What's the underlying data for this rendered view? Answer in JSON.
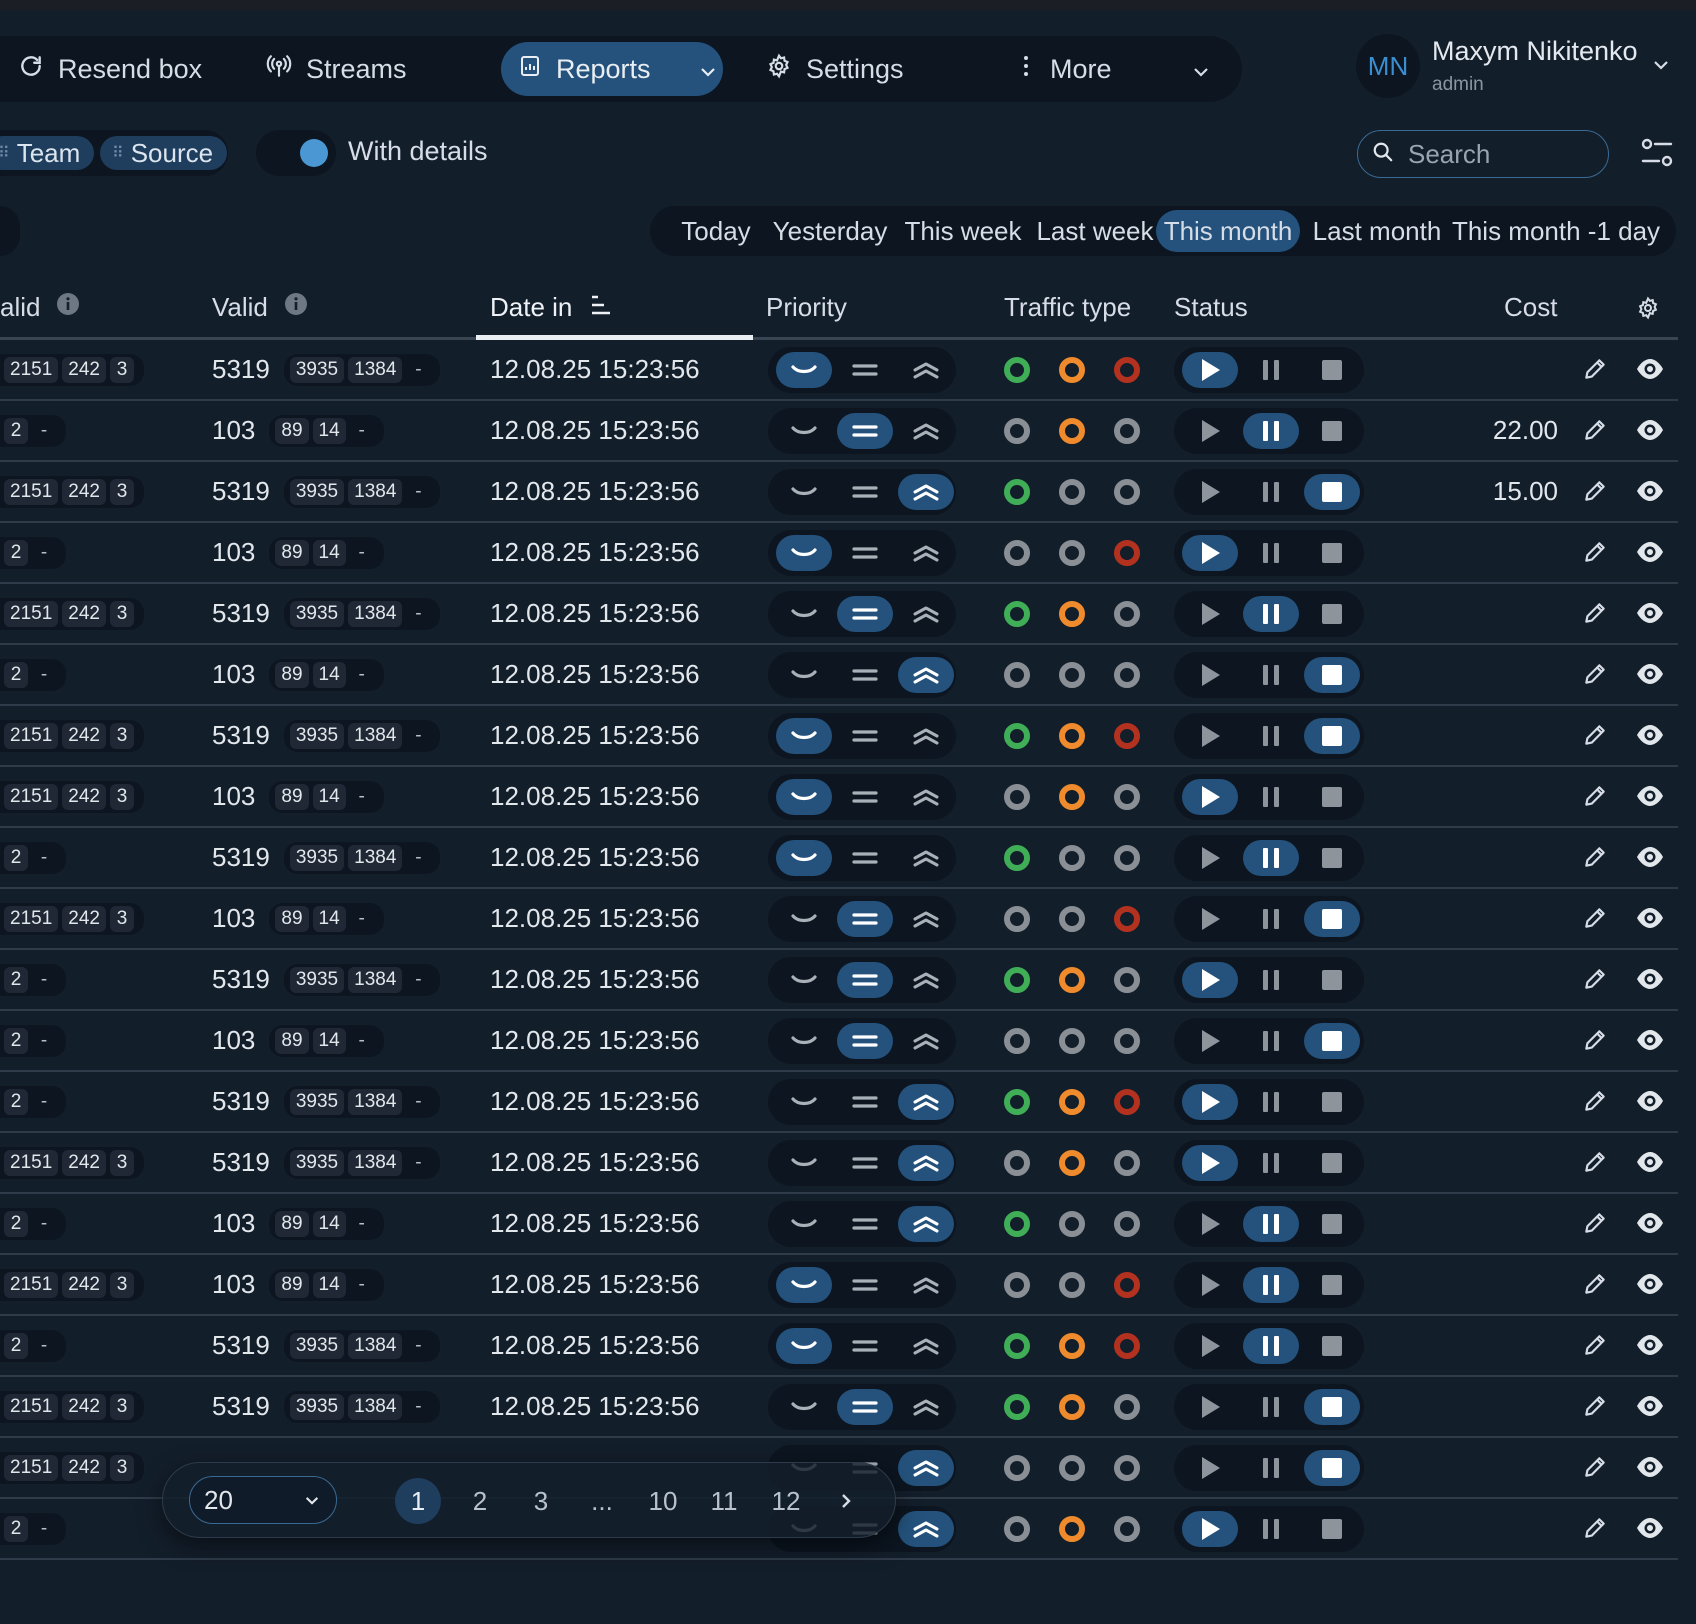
{
  "nav": {
    "items": [
      {
        "label": "Resend box",
        "icon": "refresh-icon"
      },
      {
        "label": "Streams",
        "icon": "broadcast-icon"
      },
      {
        "label": "Reports",
        "icon": "report-icon"
      },
      {
        "label": "Settings",
        "icon": "gear-icon"
      },
      {
        "label": "More",
        "icon": "more-vertical-icon"
      }
    ],
    "active": "Reports"
  },
  "user": {
    "initials": "MN",
    "name": "Maxym Nikitenko",
    "role": "admin"
  },
  "filters": {
    "chips": [
      "Team",
      "Source"
    ],
    "toggle_label": "With details",
    "toggle_on": true,
    "search_placeholder": "Search"
  },
  "date_ranges": {
    "items": [
      "Today",
      "Yesterday",
      "This week",
      "Last week",
      "This month",
      "Last month",
      "This month -1 day"
    ],
    "active": "This month"
  },
  "table": {
    "headers": {
      "invalid": "alid",
      "valid": "Valid",
      "date_in": "Date in",
      "priority": "Priority",
      "traffic_type": "Traffic type",
      "status": "Status",
      "cost": "Cost"
    },
    "rows": [
      {
        "inv": [
          "2151",
          "242",
          "3"
        ],
        "valid": "5319",
        "vb": [
          "3935",
          "1384",
          "-"
        ],
        "date": "12.08.25 15:23:56",
        "priority": "low",
        "traffic": [
          "green",
          "orange",
          "red"
        ],
        "status": "play",
        "cost": ""
      },
      {
        "inv": [
          "2",
          "-"
        ],
        "valid": "103",
        "vb": [
          "89",
          "14",
          "-"
        ],
        "date": "12.08.25 15:23:56",
        "priority": "medium",
        "traffic": [
          "grey",
          "orange",
          "grey"
        ],
        "status": "pause",
        "cost": "22.00"
      },
      {
        "inv": [
          "2151",
          "242",
          "3"
        ],
        "valid": "5319",
        "vb": [
          "3935",
          "1384",
          "-"
        ],
        "date": "12.08.25 15:23:56",
        "priority": "high",
        "traffic": [
          "green",
          "grey",
          "grey"
        ],
        "status": "stop",
        "cost": "15.00"
      },
      {
        "inv": [
          "2",
          "-"
        ],
        "valid": "103",
        "vb": [
          "89",
          "14",
          "-"
        ],
        "date": "12.08.25 15:23:56",
        "priority": "low",
        "traffic": [
          "grey",
          "grey",
          "red"
        ],
        "status": "play",
        "cost": ""
      },
      {
        "inv": [
          "2151",
          "242",
          "3"
        ],
        "valid": "5319",
        "vb": [
          "3935",
          "1384",
          "-"
        ],
        "date": "12.08.25 15:23:56",
        "priority": "medium",
        "traffic": [
          "green",
          "orange",
          "grey"
        ],
        "status": "pause",
        "cost": ""
      },
      {
        "inv": [
          "2",
          "-"
        ],
        "valid": "103",
        "vb": [
          "89",
          "14",
          "-"
        ],
        "date": "12.08.25 15:23:56",
        "priority": "high",
        "traffic": [
          "grey",
          "grey",
          "grey"
        ],
        "status": "stop",
        "cost": ""
      },
      {
        "inv": [
          "2151",
          "242",
          "3"
        ],
        "valid": "5319",
        "vb": [
          "3935",
          "1384",
          "-"
        ],
        "date": "12.08.25 15:23:56",
        "priority": "low",
        "traffic": [
          "green",
          "orange",
          "red"
        ],
        "status": "stop",
        "cost": ""
      },
      {
        "inv": [
          "2151",
          "242",
          "3"
        ],
        "valid": "103",
        "vb": [
          "89",
          "14",
          "-"
        ],
        "date": "12.08.25 15:23:56",
        "priority": "low",
        "traffic": [
          "grey",
          "orange",
          "grey"
        ],
        "status": "play",
        "cost": ""
      },
      {
        "inv": [
          "2",
          "-"
        ],
        "valid": "5319",
        "vb": [
          "3935",
          "1384",
          "-"
        ],
        "date": "12.08.25 15:23:56",
        "priority": "low",
        "traffic": [
          "green",
          "grey",
          "grey"
        ],
        "status": "pause",
        "cost": ""
      },
      {
        "inv": [
          "2151",
          "242",
          "3"
        ],
        "valid": "103",
        "vb": [
          "89",
          "14",
          "-"
        ],
        "date": "12.08.25 15:23:56",
        "priority": "medium",
        "traffic": [
          "grey",
          "grey",
          "red"
        ],
        "status": "stop",
        "cost": ""
      },
      {
        "inv": [
          "2",
          "-"
        ],
        "valid": "5319",
        "vb": [
          "3935",
          "1384",
          "-"
        ],
        "date": "12.08.25 15:23:56",
        "priority": "medium",
        "traffic": [
          "green",
          "orange",
          "grey"
        ],
        "status": "play",
        "cost": ""
      },
      {
        "inv": [
          "2",
          "-"
        ],
        "valid": "103",
        "vb": [
          "89",
          "14",
          "-"
        ],
        "date": "12.08.25 15:23:56",
        "priority": "medium",
        "traffic": [
          "grey",
          "grey",
          "grey"
        ],
        "status": "stop",
        "cost": ""
      },
      {
        "inv": [
          "2",
          "-"
        ],
        "valid": "5319",
        "vb": [
          "3935",
          "1384",
          "-"
        ],
        "date": "12.08.25 15:23:56",
        "priority": "high",
        "traffic": [
          "green",
          "orange",
          "red"
        ],
        "status": "play",
        "cost": ""
      },
      {
        "inv": [
          "2151",
          "242",
          "3"
        ],
        "valid": "5319",
        "vb": [
          "3935",
          "1384",
          "-"
        ],
        "date": "12.08.25 15:23:56",
        "priority": "high",
        "traffic": [
          "grey",
          "orange",
          "grey"
        ],
        "status": "play",
        "cost": ""
      },
      {
        "inv": [
          "2",
          "-"
        ],
        "valid": "103",
        "vb": [
          "89",
          "14",
          "-"
        ],
        "date": "12.08.25 15:23:56",
        "priority": "high",
        "traffic": [
          "green",
          "grey",
          "grey"
        ],
        "status": "pause",
        "cost": ""
      },
      {
        "inv": [
          "2151",
          "242",
          "3"
        ],
        "valid": "103",
        "vb": [
          "89",
          "14",
          "-"
        ],
        "date": "12.08.25 15:23:56",
        "priority": "low",
        "traffic": [
          "grey",
          "grey",
          "red"
        ],
        "status": "pause",
        "cost": ""
      },
      {
        "inv": [
          "2",
          "-"
        ],
        "valid": "5319",
        "vb": [
          "3935",
          "1384",
          "-"
        ],
        "date": "12.08.25 15:23:56",
        "priority": "low",
        "traffic": [
          "green",
          "orange",
          "red"
        ],
        "status": "pause",
        "cost": ""
      },
      {
        "inv": [
          "2151",
          "242",
          "3"
        ],
        "valid": "5319",
        "vb": [
          "3935",
          "1384",
          "-"
        ],
        "date": "12.08.25 15:23:56",
        "priority": "medium",
        "traffic": [
          "green",
          "orange",
          "grey"
        ],
        "status": "stop",
        "cost": ""
      },
      {
        "inv": [
          "2151",
          "242",
          "3"
        ],
        "valid": "",
        "vb": [],
        "date": "",
        "priority": "high",
        "traffic": [
          "grey",
          "grey",
          "grey"
        ],
        "status": "stop",
        "cost": ""
      },
      {
        "inv": [
          "2",
          "-"
        ],
        "valid": "",
        "vb": [],
        "date": "",
        "priority": "high",
        "traffic": [
          "grey",
          "orange",
          "grey"
        ],
        "status": "play",
        "cost": ""
      }
    ]
  },
  "pagination": {
    "page_size": "20",
    "pages": [
      "1",
      "2",
      "3",
      "...",
      "10",
      "11",
      "12"
    ],
    "active": "1"
  },
  "colors": {
    "accent": "#24527c",
    "background": "#131e2b",
    "green": "#3fae56",
    "orange": "#ef8b2c",
    "red": "#b3321f"
  }
}
